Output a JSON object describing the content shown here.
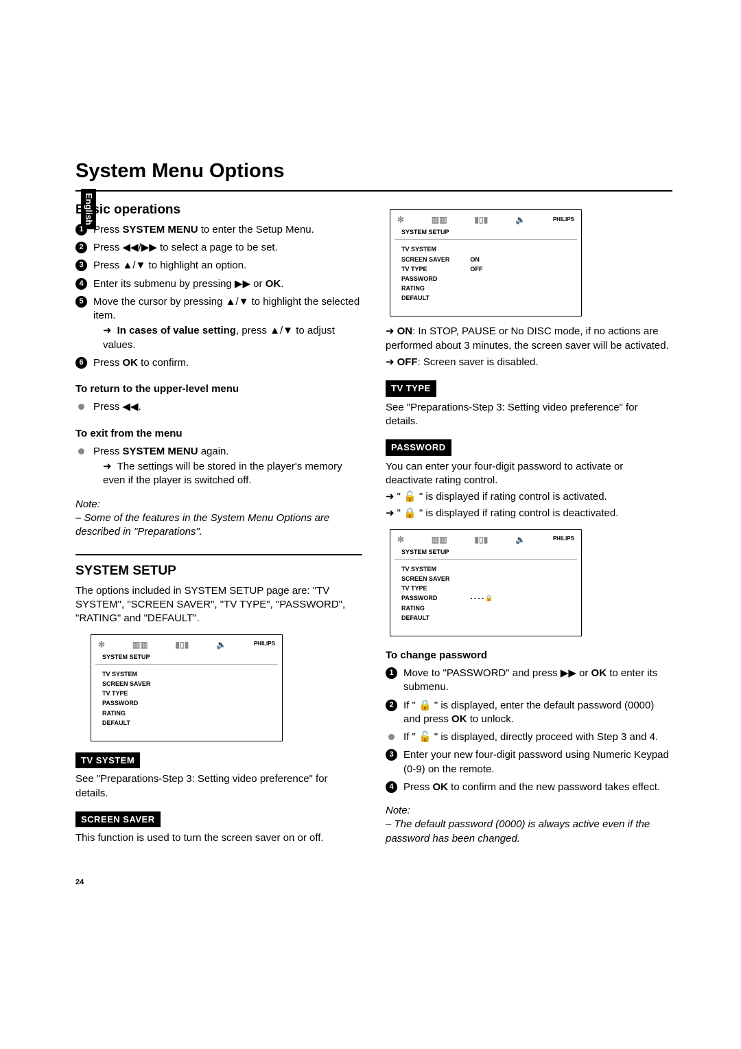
{
  "sidetab": "English",
  "title": "System Menu Options",
  "left": {
    "basic_heading": "Basic operations",
    "s1_a": "Press ",
    "s1_b": "SYSTEM MENU",
    "s1_c": " to enter the Setup Menu.",
    "s2": "Press ◀◀/▶▶ to select a page to be set.",
    "s3": "Press ▲/▼ to highlight an option.",
    "s4_a": "Enter its submenu by pressing ▶▶ or ",
    "s4_b": "OK",
    "s4_c": ".",
    "s5": "Move the cursor by pressing ▲/▼ to highlight the selected item.",
    "s5_sub_a": "In cases of value setting",
    "s5_sub_b": ", press ▲/▼ to adjust values.",
    "s6_a": "Press ",
    "s6_b": "OK",
    "s6_c": " to confirm.",
    "return_h": "To return to the upper-level menu",
    "return_b": "Press ◀◀.",
    "exit_h": "To exit from the menu",
    "exit_b1_a": "Press ",
    "exit_b1_b": "SYSTEM MENU",
    "exit_b1_c": " again.",
    "exit_sub": "The settings will be stored in the player's memory even if the player is switched off.",
    "note_h": "Note:",
    "note_b": "– Some of the features in the System Menu Options are described in \"Preparations\".",
    "sys_heading": "SYSTEM SETUP",
    "sys_intro": "The options included in SYSTEM SETUP page are: \"TV SYSTEM\", \"SCREEN SAVER\", \"TV TYPE\", \"PASSWORD\", \"RATING\" and \"DEFAULT\".",
    "tv_system": "TV SYSTEM",
    "tv_system_body": "See \"Preparations-Step 3: Setting video preference\" for details.",
    "screen_saver": "SCREEN SAVER",
    "screen_saver_body": "This function is used to turn the screen saver on or off."
  },
  "right": {
    "on_label": "ON",
    "on_body": ": In STOP, PAUSE or No DISC mode, if no actions are performed about 3 minutes, the screen saver will be activated.",
    "off_label": "OFF",
    "off_body": ": Screen saver is disabled.",
    "tv_type": "TV TYPE",
    "tv_type_body": "See \"Preparations-Step 3: Setting video preference\" for details.",
    "password": "PASSWORD",
    "pw_intro": "You can enter your four-digit password to activate or deactivate rating control.",
    "pw_a": "\" 🔓 \" is displayed if rating control is activated.",
    "pw_b": "\" 🔒 \" is displayed if rating control is deactivated.",
    "change_h": "To change password",
    "c1_a": "Move to \"PASSWORD\" and press ▶▶ or ",
    "c1_b": "OK",
    "c1_c": " to enter its submenu.",
    "c2_a": "If \" 🔒 \" is displayed, enter the default password (0000) and press ",
    "c2_b": "OK",
    "c2_c": " to unlock.",
    "c2b": "If \" 🔓 \" is displayed, directly proceed with Step 3 and 4.",
    "c3": "Enter your new four-digit password using Numeric Keypad (0-9) on the remote.",
    "c4_a": "Press ",
    "c4_b": "OK",
    "c4_c": " to confirm and the new password takes effect.",
    "note_h": "Note:",
    "note_b": "– The default password (0000) is always active even if the password has been changed."
  },
  "osd": {
    "brand": "PHILIPS",
    "section": "SYSTEM SETUP",
    "items": [
      "TV SYSTEM",
      "SCREEN SAVER",
      "TV TYPE",
      "PASSWORD",
      "RATING",
      "DEFAULT"
    ],
    "vals_ss": [
      "ON",
      "OFF"
    ],
    "vals_pw": "- - - - 🔒"
  },
  "page_num": "24"
}
